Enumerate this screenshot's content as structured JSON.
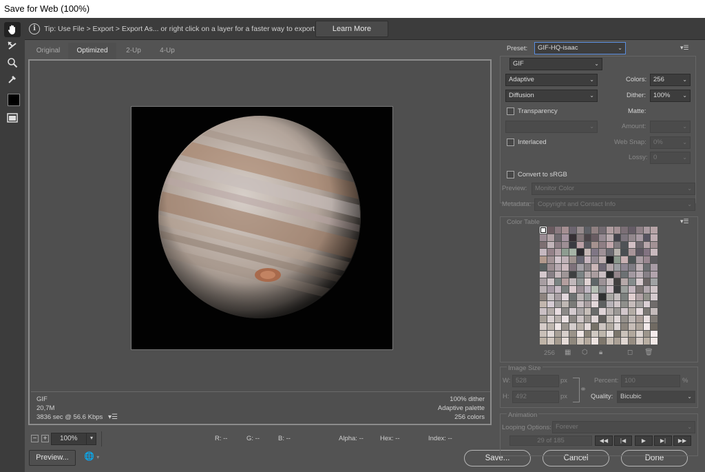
{
  "window": {
    "title": "Save for Web (100%)"
  },
  "tools": [
    "hand-icon",
    "slice-select-icon",
    "zoom-icon",
    "eyedropper-icon",
    "eyedropper-color-swatch",
    "toggle-slices-icon"
  ],
  "tipbar": {
    "tip": "Tip: Use File > Export > Export As...  or right click on a layer for a faster way to export assets",
    "learn_more": "Learn More"
  },
  "tabs": [
    "Original",
    "Optimized",
    "2-Up",
    "4-Up"
  ],
  "status": {
    "format": "GIF",
    "size": "20,7M",
    "time": "3836 sec @ 56.6 Kbps",
    "dither": "100% dither",
    "palette": "Adaptive palette",
    "colors": "256 colors"
  },
  "zoom": {
    "minus": "−",
    "plus": "+",
    "value": "100%"
  },
  "pixel_info": {
    "r": "R: --",
    "g": "G: --",
    "b": "B: --",
    "alpha": "Alpha: --",
    "hex": "Hex: --",
    "index": "Index: --"
  },
  "buttons": {
    "preview": "Preview...",
    "save": "Save...",
    "cancel": "Cancel",
    "done": "Done"
  },
  "settings": {
    "preset_label": "Preset:",
    "preset_value": "GIF-HQ-isaac",
    "format": "GIF",
    "reduction": "Adaptive",
    "dither_algo": "Diffusion",
    "colors_label": "Colors:",
    "colors_value": "256",
    "dither_label": "Dither:",
    "dither_value": "100%",
    "transparency_label": "Transparency",
    "matte_label": "Matte:",
    "amount_label": "Amount:",
    "interlaced_label": "Interlaced",
    "websnap_label": "Web Snap:",
    "websnap_value": "0%",
    "lossy_label": "Lossy:",
    "lossy_value": "0",
    "convert_label": "Convert to sRGB",
    "preview_label": "Preview:",
    "preview_value": "Monitor Color",
    "metadata_label": "Metadata:",
    "metadata_value": "Copyright and Contact Info"
  },
  "color_table": {
    "title": "Color Table",
    "count": "256",
    "colors": [
      "#ffffff",
      "#6a5b60",
      "#8b7a80",
      "#a58f92",
      "#6c6570",
      "#968a8c",
      "#5d5f65",
      "#8f8081",
      "#736b72",
      "#b09da0",
      "#a39094",
      "#7b6f76",
      "#655c66",
      "#8e8086",
      "#aa9aa0",
      "#b7a4a7",
      "#9a8b93",
      "#b2a2a6",
      "#6f6a6f",
      "#a594a0",
      "#362f34",
      "#827578",
      "#4b4448",
      "#685c62",
      "#968a92",
      "#b8aaae",
      "#43434b",
      "#7c747d",
      "#93888d",
      "#a89aa3",
      "#575461",
      "#c0aeb3",
      "#7d6f72",
      "#c2b5ba",
      "#8c7d84",
      "#9e8f95",
      "#3a3b41",
      "#bba1a6",
      "#5a5960",
      "#a5928f",
      "#8e7e84",
      "#c1a7ac",
      "#817b7f",
      "#4f5256",
      "#d2bfc4",
      "#6e676e",
      "#b7a5aa",
      "#a39295",
      "#c5b8c0",
      "#948289",
      "#b5a4aa",
      "#8d9c90",
      "#a6b4a6",
      "#2c2a2f",
      "#c4b6b4",
      "#7f7685",
      "#9f9197",
      "#6b6a72",
      "#b8b3ae",
      "#4a4f52",
      "#a89599",
      "#5e5862",
      "#827381",
      "#c9b9be",
      "#b29a8d",
      "#a29396",
      "#d1c4cb",
      "#c1b3b9",
      "#9f938f",
      "#676673",
      "#c8b6bf",
      "#938992",
      "#bfafb1",
      "#1e1e22",
      "#8c9a8e",
      "#c9b1b3",
      "#4d5455",
      "#ab9ea4",
      "#9a8891",
      "#5c5a5e",
      "#585f5f",
      "#9b8d91",
      "#b6a9b0",
      "#cdbbc0",
      "#7d717a",
      "#a4a0a6",
      "#8b8589",
      "#cab6b8",
      "#6e6774",
      "#b2a5a9",
      "#9a9ca0",
      "#8d8591",
      "#7e7c83",
      "#bfb2b7",
      "#6b6e71",
      "#a89ca6",
      "#d5c8cd",
      "#888086",
      "#c6b9bd",
      "#9f9697",
      "#3e4041",
      "#7c8485",
      "#b6abad",
      "#aa9d9f",
      "#cbbfc3",
      "#2a2c2d",
      "#94868b",
      "#6c7173",
      "#a399a1",
      "#bcb0b7",
      "#878087",
      "#b2a4ad",
      "#a89ea2",
      "#d1c6ca",
      "#7b8483",
      "#b49f9f",
      "#c1b8bb",
      "#909695",
      "#e0d3d3",
      "#5f6668",
      "#9c9296",
      "#c9bec0",
      "#42403f",
      "#b6a9a9",
      "#858c8c",
      "#d8cbcf",
      "#6c6565",
      "#a0a3a4",
      "#b9b0b3",
      "#a69aa5",
      "#c8bbc5",
      "#7a7f7e",
      "#dbcbcf",
      "#9a8e95",
      "#c1b8c3",
      "#b6bfb5",
      "#8b8e90",
      "#d1c2c9",
      "#3b3c3d",
      "#9b9f9c",
      "#c5b7bf",
      "#7f7776",
      "#b3a8ae",
      "#d0c5c8",
      "#8d847f",
      "#c8c2c4",
      "#a79fa3",
      "#e1d7dc",
      "#6d7272",
      "#bab4b5",
      "#959b9a",
      "#d8cdd2",
      "#2f3131",
      "#a9a8a4",
      "#c3bdbd",
      "#7c807e",
      "#e0cfd0",
      "#b2a3a6",
      "#909089",
      "#d5cbcf",
      "#c2b6ae",
      "#d6ccd4",
      "#9e9c9b",
      "#bfb8b4",
      "#7a7b78",
      "#ccc2c5",
      "#a99ea0",
      "#e3d8da",
      "#5e6161",
      "#b8b3b8",
      "#d0c6c8",
      "#8f8f8b",
      "#c6bcbb",
      "#a5a2a0",
      "#dbd0d5",
      "#706c6b",
      "#cac0c4",
      "#b4aca9",
      "#e8dce0",
      "#8c8a88",
      "#d4cbcf",
      "#aaa5a6",
      "#c7beb9",
      "#6a6c6b",
      "#dfd4d7",
      "#bcb5b3",
      "#9b9895",
      "#d2c7cb",
      "#b3aca5",
      "#e6dbde",
      "#7b7874",
      "#c4bbbb",
      "#a59e96",
      "#d9d0d1",
      "#b9b2ae",
      "#ece2e4",
      "#8a8682",
      "#cfc6c7",
      "#a29c97",
      "#e0d6d7",
      "#615f5c",
      "#c4bdb8",
      "#dfd7d7",
      "#948f8a",
      "#c0b9b6",
      "#ab9f99",
      "#e9dfe0",
      "#7f7a75",
      "#d6ccc9",
      "#beb6af",
      "#efe6e7",
      "#9b958f",
      "#d4cdcc",
      "#b8b0a8",
      "#e5dbdb",
      "#767168",
      "#cdc5c1",
      "#b2aba2",
      "#dcd5d4",
      "#8c857d",
      "#c6bdb7",
      "#aea59c",
      "#f2e9ea",
      "#706a62",
      "#c9c0b8",
      "#e2dad8",
      "#a8a097",
      "#d7cfcb",
      "#9a9389",
      "#f0e7e6",
      "#8a8378",
      "#d0c9c2",
      "#bdb6ac",
      "#e8e1df",
      "#7c766c",
      "#cac2ba",
      "#b1a89d",
      "#ddd5d1",
      "#9d968c",
      "#f5eced",
      "#bfb4a7",
      "#d3c9c1",
      "#a69c90",
      "#e6dcd8",
      "#8f887d",
      "#cfc5bc",
      "#b5aa9e",
      "#ede3e0",
      "#7e776c",
      "#c7bdb3",
      "#aba196",
      "#e0d7d2",
      "#968d82",
      "#d8cec8",
      "#bab0a4",
      "#f3eae8"
    ]
  },
  "image_size": {
    "title": "Image Size",
    "w_label": "W:",
    "w_value": "528",
    "h_label": "H:",
    "h_value": "492",
    "unit": "px",
    "percent_label": "Percent:",
    "percent_value": "100",
    "percent_unit": "%",
    "quality_label": "Quality:",
    "quality_value": "Bicubic"
  },
  "animation": {
    "title": "Animation",
    "looping_label": "Looping Options:",
    "looping_value": "Forever",
    "frame": "29 of 185"
  }
}
